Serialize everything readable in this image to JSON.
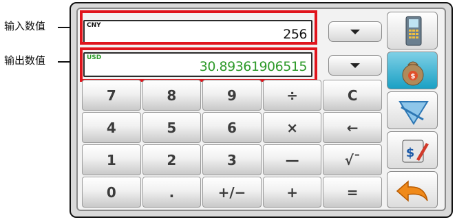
{
  "callouts": {
    "input_label": "输入数值",
    "output_label": "输出数值"
  },
  "input_display": {
    "currency": "CNY",
    "value": "256"
  },
  "output_display": {
    "currency": "USD",
    "value": "30.89361906515"
  },
  "keypad": [
    [
      "7",
      "8",
      "9",
      "÷",
      "C"
    ],
    [
      "4",
      "5",
      "6",
      "×",
      "←"
    ],
    [
      "1",
      "2",
      "3",
      "—",
      "√¯"
    ],
    [
      "0",
      ".",
      "+/−",
      "+",
      "="
    ]
  ],
  "tools": [
    "phone-icon",
    "money-bag-icon",
    "ruler-triangle-icon",
    "calculator-pen-icon",
    "back-arrow-icon"
  ],
  "colors": {
    "highlight": "#e0141c",
    "output_text": "#2e9a2a",
    "input_text": "#111111",
    "active_tool": "#1aa0c4"
  }
}
